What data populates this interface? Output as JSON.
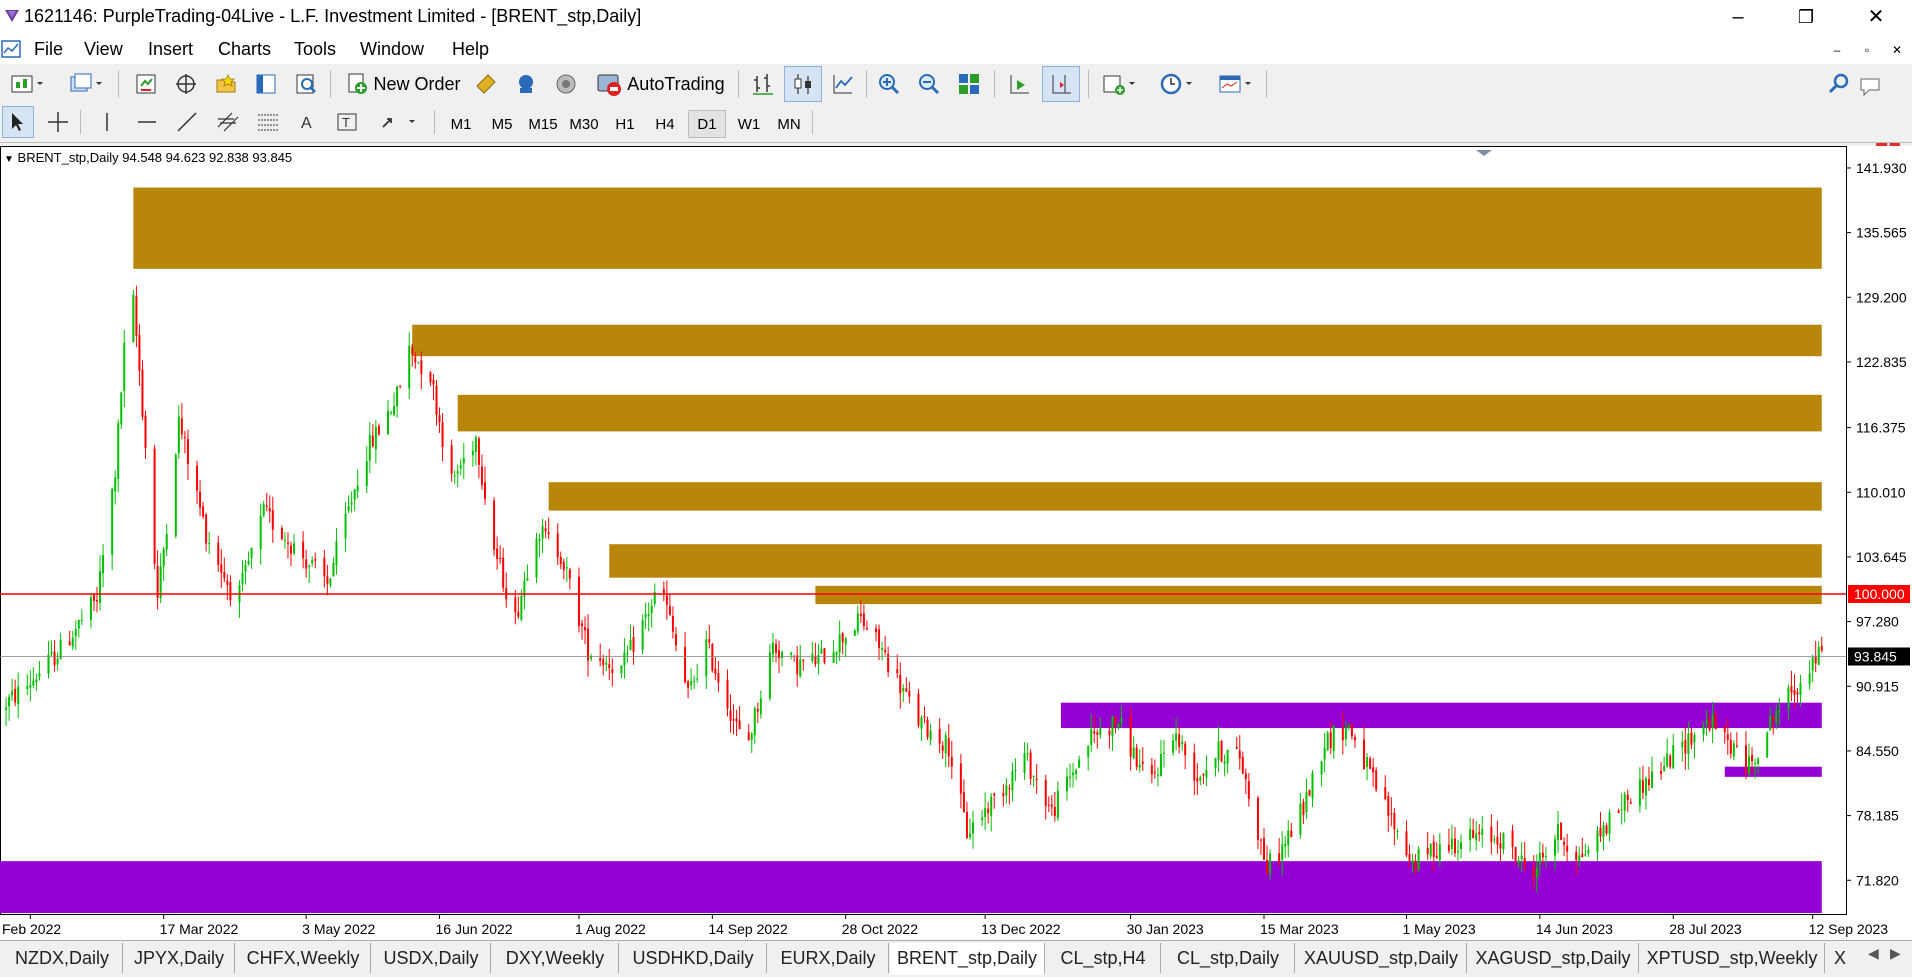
{
  "window": {
    "title": "1621146: PurpleTrading-04Live - L.F. Investment Limited - [BRENT_stp,Daily]",
    "minimize": "–",
    "maximize": "❐",
    "close": "✕"
  },
  "menu": {
    "items": [
      "File",
      "View",
      "Insert",
      "Charts",
      "Tools",
      "Window",
      "Help"
    ],
    "mdi_buttons": [
      "–",
      "▫",
      "✕"
    ]
  },
  "toolbar": {
    "new_order_label": "New Order",
    "autotrading_label": "AutoTrading",
    "notification_count": "1",
    "icons": [
      "new-chart-icon",
      "profiles-icon",
      "market-watch-icon",
      "data-window-icon",
      "navigator-icon",
      "terminal-icon",
      "strategy-tester-icon",
      "new-order-icon",
      "metaeditor-icon",
      "signals-icon",
      "autotrading-icon",
      "bar-chart-icon",
      "candlestick-icon",
      "line-chart-icon",
      "zoom-in-icon",
      "zoom-out-icon",
      "tile-windows-icon",
      "autoscroll-icon",
      "chart-shift-icon",
      "indicators-icon",
      "periods-icon",
      "templates-icon",
      "search-icon",
      "chat-icon"
    ]
  },
  "drawing_tools": [
    "cursor-icon",
    "crosshair-icon",
    "vertical-line-icon",
    "horizontal-line-icon",
    "trendline-icon",
    "equidistant-channel-icon",
    "fibonacci-icon",
    "text-icon",
    "text-label-icon",
    "arrows-icon"
  ],
  "timeframes": [
    "M1",
    "M5",
    "M15",
    "M30",
    "H1",
    "H4",
    "D1",
    "W1",
    "MN"
  ],
  "active_timeframe": "D1",
  "chart_data": {
    "type": "candlestick",
    "symbol_info": "BRENT_stp,Daily  94.548 94.623 92.838 93.845",
    "colors": {
      "bull": "#00c000",
      "bear": "#ff0000",
      "supply_zone": "#b8860b",
      "demand_zone": "#9400d3",
      "level_line": "#ff0000",
      "bid_line": "#808080"
    },
    "y_axis": {
      "ticks": [
        "141.930",
        "135.565",
        "129.200",
        "122.835",
        "116.375",
        "110.010",
        "103.645",
        "97.280",
        "90.915",
        "84.550",
        "78.185",
        "71.820"
      ],
      "ylim": [
        68.5,
        143.5
      ]
    },
    "x_axis": {
      "ticks": [
        "1 Feb 2022",
        "17 Mar 2022",
        "3 May 2022",
        "16 Jun 2022",
        "1 Aug 2022",
        "14 Sep 2022",
        "28 Oct 2022",
        "13 Dec 2022",
        "30 Jan 2023",
        "15 Mar 2023",
        "1 May 2023",
        "14 Jun 2023",
        "28 Jul 2023",
        "12 Sep 2023"
      ],
      "start": "2022-01-22",
      "end": "2023-09-23"
    },
    "level_line": {
      "value": 100.0,
      "label": "100.000"
    },
    "bid_line": {
      "value": 93.845,
      "label": "93.845"
    },
    "supply_zones": [
      {
        "start": "2022-03-07",
        "end": "2023-09-15",
        "low": 132.0,
        "high": 140.0
      },
      {
        "start": "2022-06-07",
        "end": "2023-09-15",
        "low": 123.4,
        "high": 126.5
      },
      {
        "start": "2022-06-22",
        "end": "2023-09-15",
        "low": 116.0,
        "high": 119.6
      },
      {
        "start": "2022-07-22",
        "end": "2023-09-15",
        "low": 108.2,
        "high": 111.0
      },
      {
        "start": "2022-08-11",
        "end": "2023-09-15",
        "low": 101.6,
        "high": 104.9
      },
      {
        "start": "2022-10-18",
        "end": "2023-09-15",
        "low": 99.0,
        "high": 100.8
      }
    ],
    "demand_zones": [
      {
        "start": "2023-01-07",
        "end": "2023-09-15",
        "low": 86.8,
        "high": 89.3
      },
      {
        "start": "2023-08-14",
        "end": "2023-09-15",
        "low": 82.0,
        "high": 83.0
      },
      {
        "start": "2022-01-22",
        "end": "2023-09-15",
        "low": 68.6,
        "high": 73.7
      }
    ],
    "price_path": [
      [
        "2022-01-22",
        88.5
      ],
      [
        "2022-02-01",
        91.0
      ],
      [
        "2022-02-12",
        94.5
      ],
      [
        "2022-02-24",
        99.5
      ],
      [
        "2022-03-02",
        112.0
      ],
      [
        "2022-03-07",
        132.0
      ],
      [
        "2022-03-10",
        122.0
      ],
      [
        "2022-03-16",
        99.5
      ],
      [
        "2022-03-23",
        117.0
      ],
      [
        "2022-04-01",
        106.0
      ],
      [
        "2022-04-11",
        99.0
      ],
      [
        "2022-04-20",
        108.0
      ],
      [
        "2022-05-02",
        104.0
      ],
      [
        "2022-05-11",
        101.0
      ],
      [
        "2022-05-23",
        113.5
      ],
      [
        "2022-06-03",
        119.5
      ],
      [
        "2022-06-07",
        124.0
      ],
      [
        "2022-06-14",
        121.5
      ],
      [
        "2022-06-21",
        111.0
      ],
      [
        "2022-06-29",
        115.5
      ],
      [
        "2022-07-05",
        104.5
      ],
      [
        "2022-07-12",
        97.5
      ],
      [
        "2022-07-19",
        106.5
      ],
      [
        "2022-07-27",
        104.0
      ],
      [
        "2022-08-05",
        94.5
      ],
      [
        "2022-08-16",
        92.5
      ],
      [
        "2022-08-29",
        101.0
      ],
      [
        "2022-09-07",
        90.0
      ],
      [
        "2022-09-13",
        95.0
      ],
      [
        "2022-09-26",
        84.5
      ],
      [
        "2022-10-05",
        95.0
      ],
      [
        "2022-10-12",
        93.0
      ],
      [
        "2022-10-20",
        93.5
      ],
      [
        "2022-11-03",
        97.5
      ],
      [
        "2022-11-10",
        94.5
      ],
      [
        "2022-11-22",
        87.5
      ],
      [
        "2022-12-02",
        85.0
      ],
      [
        "2022-12-08",
        76.5
      ],
      [
        "2022-12-20",
        81.0
      ],
      [
        "2022-12-27",
        84.0
      ],
      [
        "2023-01-05",
        78.5
      ],
      [
        "2023-01-18",
        86.0
      ],
      [
        "2023-01-27",
        87.5
      ],
      [
        "2023-02-06",
        81.0
      ],
      [
        "2023-02-14",
        86.5
      ],
      [
        "2023-02-22",
        82.0
      ],
      [
        "2023-03-01",
        84.5
      ],
      [
        "2023-03-08",
        84.0
      ],
      [
        "2023-03-17",
        73.0
      ],
      [
        "2023-03-22",
        75.0
      ],
      [
        "2023-03-29",
        79.0
      ],
      [
        "2023-04-05",
        85.5
      ],
      [
        "2023-04-13",
        87.0
      ],
      [
        "2023-04-21",
        81.5
      ],
      [
        "2023-05-04",
        73.5
      ],
      [
        "2023-05-12",
        75.0
      ],
      [
        "2023-05-22",
        76.0
      ],
      [
        "2023-06-02",
        76.0
      ],
      [
        "2023-06-12",
        72.5
      ],
      [
        "2023-06-21",
        76.5
      ],
      [
        "2023-06-28",
        74.0
      ],
      [
        "2023-07-05",
        76.5
      ],
      [
        "2023-07-14",
        80.0
      ],
      [
        "2023-07-24",
        82.5
      ],
      [
        "2023-08-04",
        86.0
      ],
      [
        "2023-08-10",
        87.5
      ],
      [
        "2023-08-23",
        83.0
      ],
      [
        "2023-09-01",
        88.5
      ],
      [
        "2023-09-07",
        90.5
      ],
      [
        "2023-09-13",
        93.5
      ],
      [
        "2023-09-15",
        93.8
      ]
    ]
  },
  "tabs": [
    "NZDX,Daily",
    "JPYX,Daily",
    "CHFX,Weekly",
    "USDX,Daily",
    "DXY,Weekly",
    "USDHKD,Daily",
    "EURX,Daily",
    "BRENT_stp,Daily",
    "CL_stp,H4",
    "CL_stp,Daily",
    "XAUUSD_stp,Daily",
    "XAGUSD_stp,Daily",
    "XPTUSD_stp,Weekly",
    "X"
  ],
  "active_tab": "BRENT_stp,Daily",
  "tab_arrows": [
    "◀",
    "▶"
  ]
}
